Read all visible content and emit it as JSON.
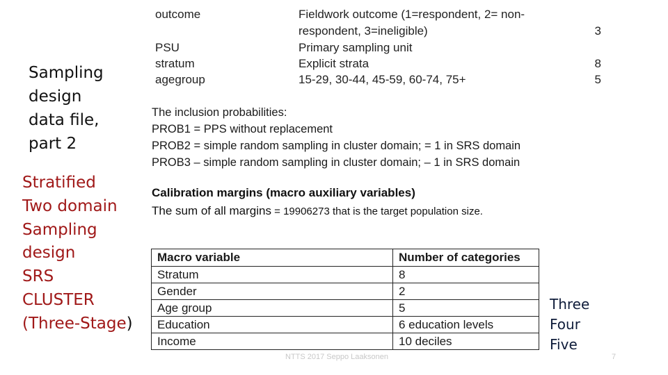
{
  "sidebar": {
    "title_lines": [
      "Sampling",
      "design",
      "data file,",
      "part 2"
    ],
    "design_lines": [
      "Stratified",
      "Two domain",
      "Sampling",
      "design",
      "SRS",
      "CLUSTER"
    ],
    "last_line_main": "(Three-Stage",
    "last_line_end": ")",
    "colors": {
      "title": "#111111",
      "design": "#a01818"
    }
  },
  "variables": [
    {
      "name": "outcome",
      "desc_line1": "Fieldwork outcome (1=respondent, 2= non-",
      "desc_line2": "respondent, 3=ineligible)",
      "count": "3"
    },
    {
      "name": "PSU",
      "desc": "Primary sampling unit",
      "count": ""
    },
    {
      "name": "stratum",
      "desc": "Explicit strata",
      "count": "8"
    },
    {
      "name": "agegroup",
      "desc": "15-29, 30-44, 45-59, 60-74, 75+",
      "count": "5"
    }
  ],
  "probabilities": {
    "heading": "The inclusion probabilities:",
    "lines": [
      "PROB1 = PPS without replacement",
      "PROB2 = simple random sampling in cluster domain; = 1 in SRS domain",
      "PROB3 – simple random sampling in cluster domain; – 1 in SRS domain"
    ]
  },
  "calibration": {
    "heading": "Calibration margins (macro auxiliary variables)",
    "sum_prefix": "The sum of all margins",
    "sum_eq": " = ",
    "sum_value": "19906273",
    "sum_suffix": " that is the target population size."
  },
  "macro_table": {
    "headers": [
      "Macro variable",
      "Number of categories"
    ],
    "rows": [
      [
        "Stratum",
        "8"
      ],
      [
        "Gender",
        "2"
      ],
      [
        "Age group",
        "5"
      ],
      [
        "Education",
        "6 education levels"
      ],
      [
        "Income",
        "10 deciles"
      ]
    ]
  },
  "right_list": [
    "Three",
    "Four",
    "Five"
  ],
  "footer": {
    "text": "NTTS 2017 Seppo Laaksonen",
    "slide_number": "7"
  }
}
